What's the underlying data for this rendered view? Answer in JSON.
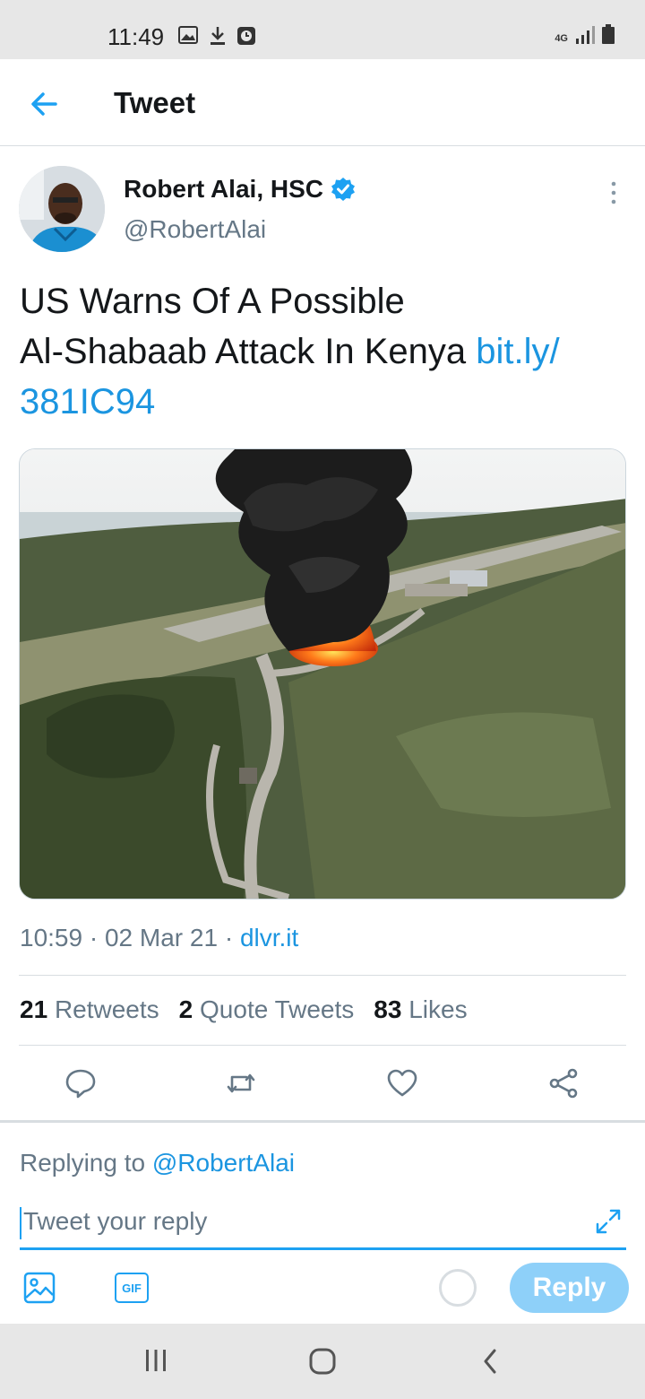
{
  "status_bar": {
    "time": "11:49",
    "network": "4G"
  },
  "header": {
    "title": "Tweet"
  },
  "tweet": {
    "author_name": "Robert Alai, HSC",
    "author_handle": "@RobertAlai",
    "text_line1": "US Warns Of A Possible",
    "text_line2": "Al-Shabaab Attack In Kenya ",
    "link_part1": "bit.ly/",
    "link_part2": "381IC94",
    "time": "10:59",
    "date": "02 Mar 21",
    "source": "dlvr.it",
    "sep": " · "
  },
  "stats": {
    "retweets_count": "21",
    "retweets_label": "Retweets",
    "quotes_count": "2",
    "quotes_label": "Quote Tweets",
    "likes_count": "83",
    "likes_label": "Likes"
  },
  "reply": {
    "replying_prefix": "Replying to ",
    "replying_handle": "@RobertAlai",
    "placeholder": "Tweet your reply",
    "gif_label": "GIF",
    "button_label": "Reply"
  },
  "colors": {
    "accent": "#1da1f2",
    "link": "#1b95e0",
    "muted": "#657786",
    "reply_button": "#8ed0f9"
  }
}
